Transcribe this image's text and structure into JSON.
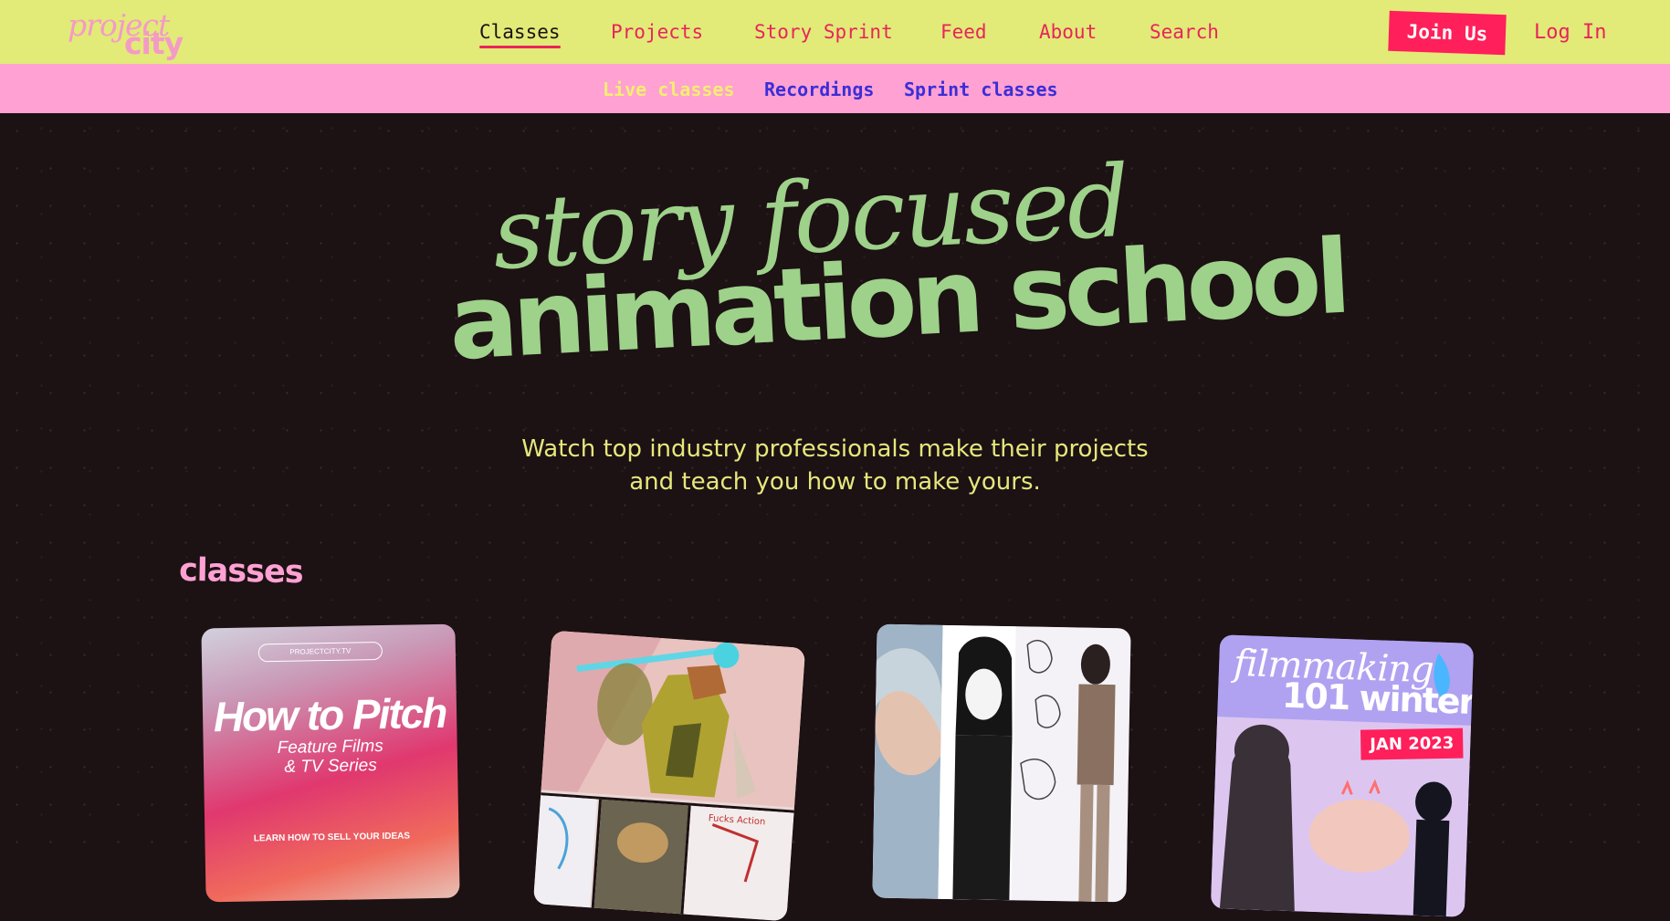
{
  "logo": {
    "line1": "project",
    "line2": "city"
  },
  "nav": {
    "links": [
      "Classes",
      "Projects",
      "Story Sprint",
      "Feed",
      "About",
      "Search"
    ],
    "join_label": "Join Us",
    "login_label": "Log In"
  },
  "subnav": {
    "links": [
      "Live classes",
      "Recordings",
      "Sprint classes"
    ]
  },
  "hero": {
    "line1": "story focused",
    "line2": "animation school",
    "tagline_line1": "Watch top industry professionals make their projects",
    "tagline_line2": "and teach you how to make yours."
  },
  "classes": {
    "heading": "classes",
    "cards": [
      {
        "site": "PROJECTCITY.TV",
        "title": "How to Pitch",
        "subtitle_line1": "Feature Films",
        "subtitle_line2": "& TV Series",
        "footer": "LEARN HOW TO SELL YOUR IDEAS"
      },
      {
        "caption": "Fucks Action"
      },
      {},
      {
        "title_line1": "filmmaking",
        "title_line2": "101 winter",
        "badge": "JAN 2023"
      }
    ]
  },
  "colors": {
    "background": "#1c1113",
    "nav_bg": "#e2ea78",
    "subnav_bg": "#ffa1d2",
    "accent_pink": "#e8245a",
    "hero_green": "#9ed18a",
    "tagline_yellow": "#e6e77c"
  }
}
